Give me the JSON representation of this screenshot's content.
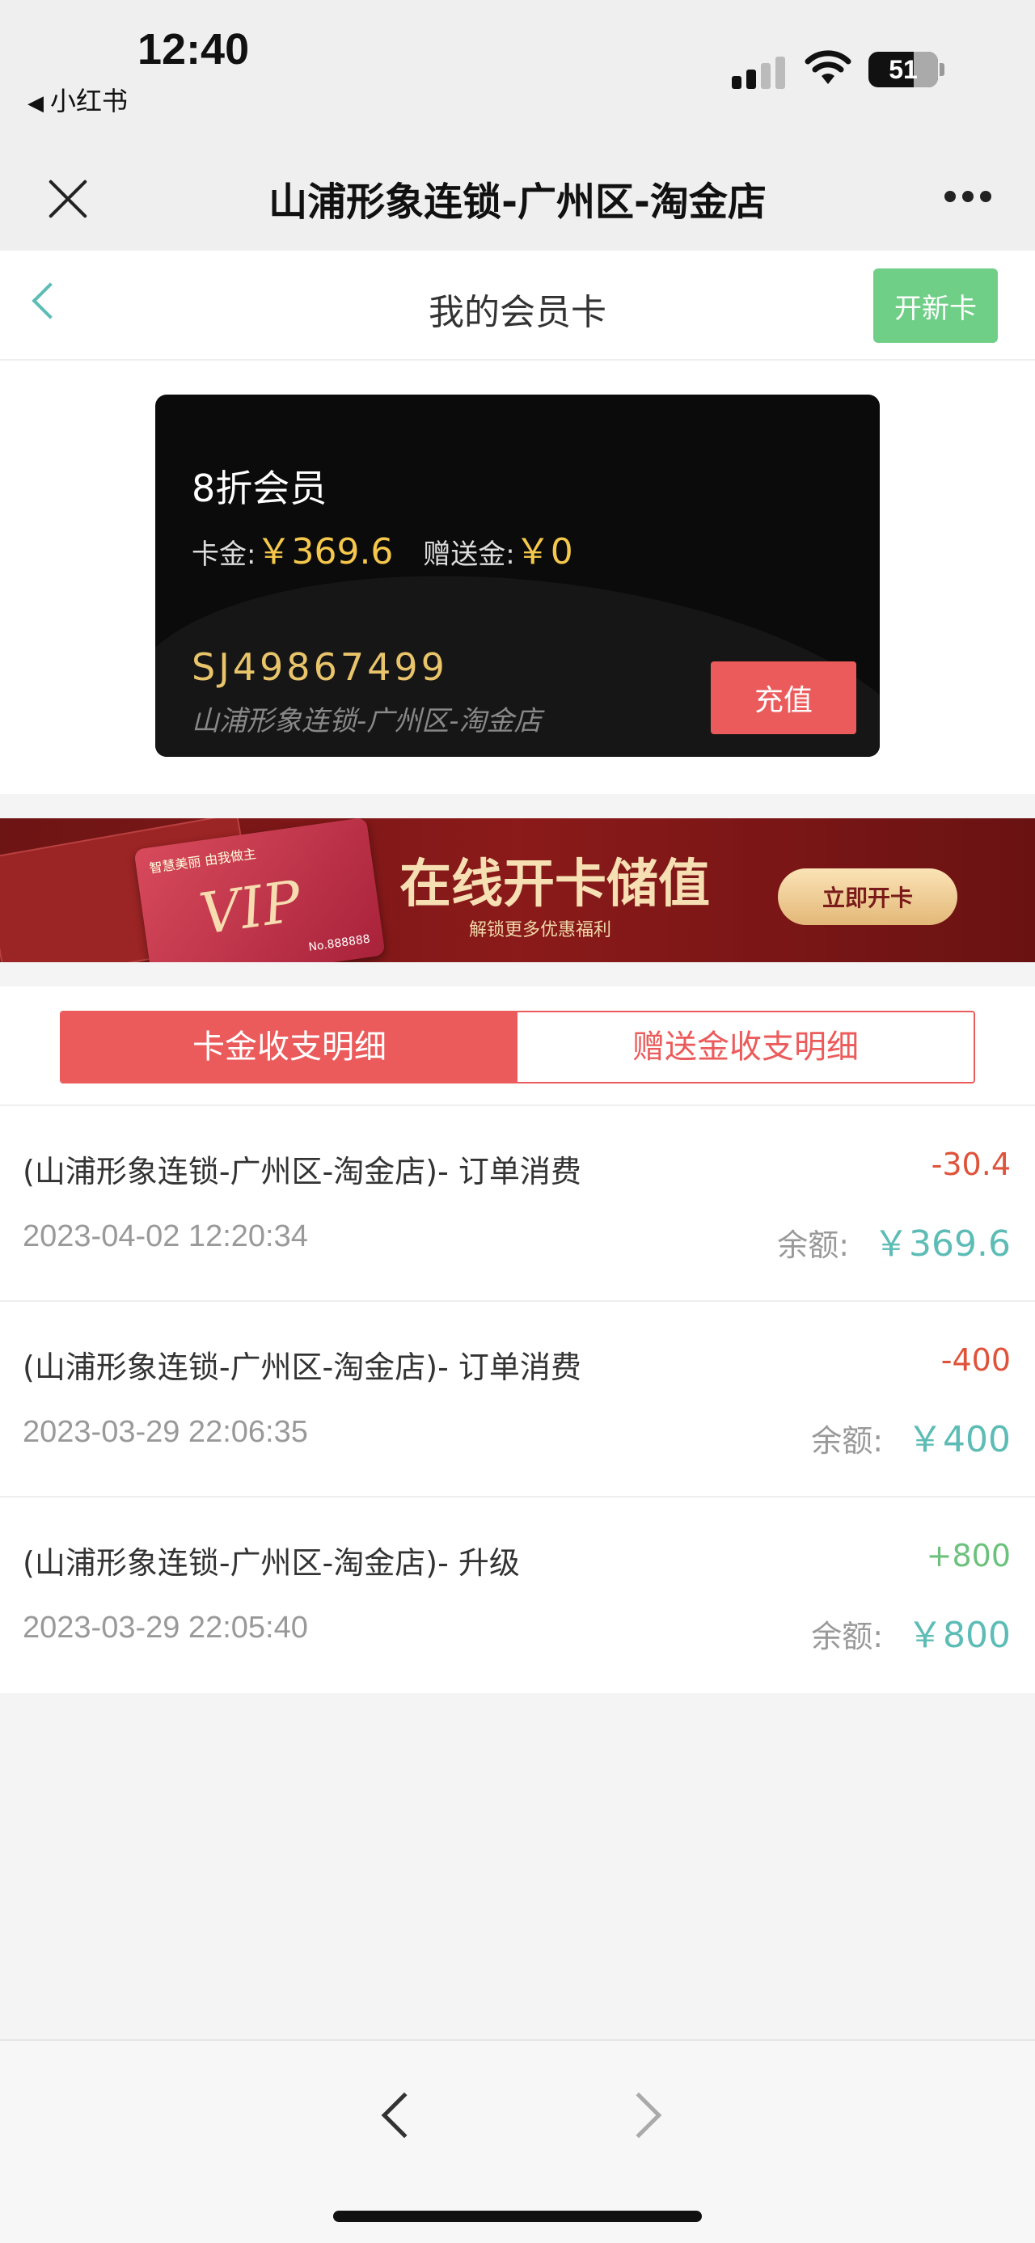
{
  "status_bar": {
    "time": "12:40",
    "back_app": "小红书",
    "battery": "51"
  },
  "mp_header": {
    "title": "山浦形象连锁-广州区-淘金店"
  },
  "page_nav": {
    "title": "我的会员卡",
    "new_card_label": "开新卡"
  },
  "card": {
    "level": "8折会员",
    "balance_label": "卡金:",
    "balance_value": "￥369.6",
    "bonus_label": "赠送金:",
    "bonus_value": "￥0",
    "number": "SJ49867499",
    "shop": "山浦形象连锁-广州区-淘金店",
    "recharge_label": "充值"
  },
  "banner": {
    "title": "在线开卡储值",
    "subtitle": "解锁更多优惠福利",
    "button_label": "立即开卡",
    "card_text": "VIP",
    "card_top": "智慧美丽 由我做主",
    "card_no": "No.888888"
  },
  "tabs": [
    "卡金收支明细",
    "赠送金收支明细"
  ],
  "balance_label": "余额:",
  "transactions": [
    {
      "title": "(山浦形象连锁-广州区-淘金店)- 订单消费",
      "amount": "-30.4",
      "date": "2023-04-02 12:20:34",
      "balance": "￥369.6"
    },
    {
      "title": "(山浦形象连锁-广州区-淘金店)- 订单消费",
      "amount": "-400",
      "date": "2023-03-29 22:06:35",
      "balance": "￥400"
    },
    {
      "title": "(山浦形象连锁-广州区-淘金店)- 升级",
      "amount": "+800",
      "date": "2023-03-29 22:05:40",
      "balance": "￥800"
    }
  ],
  "colors": {
    "accent_red": "#ec5b5b",
    "accent_green": "#6fcf86",
    "teal": "#5dbcb6",
    "gold": "#f5c84c"
  }
}
